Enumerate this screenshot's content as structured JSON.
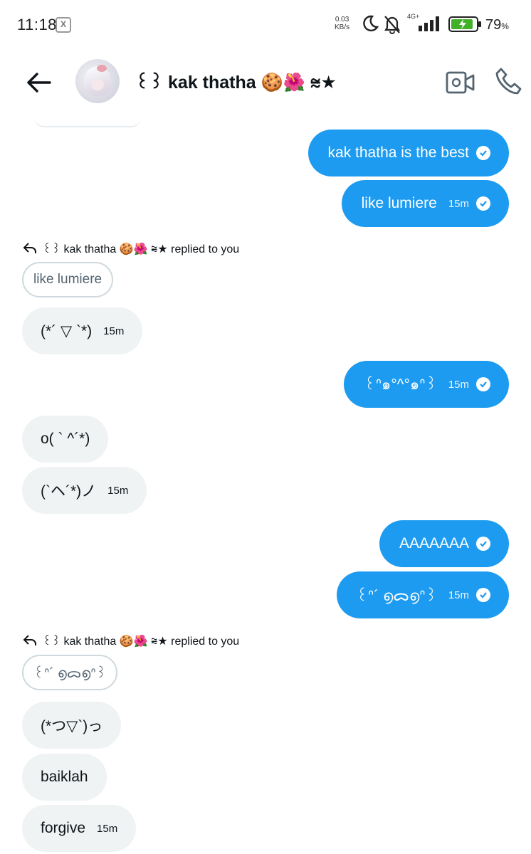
{
  "status_bar": {
    "time": "11:18",
    "speed_value": "0.03",
    "speed_unit": "KB/s",
    "network": "4G+",
    "battery": "79",
    "battery_unit": "%"
  },
  "header": {
    "title": "꒰꒱ kak thatha 🍪🌺 ⩬★"
  },
  "messages": [
    {
      "text": "kak thatha is the best"
    },
    {
      "text": "like lumiere",
      "time": "15m"
    },
    {
      "reply_label": "꒰꒱ kak thatha 🍪🌺 ⩬★ replied to you",
      "quote": "like lumiere"
    },
    {
      "text": "(*´ ▽ `*)",
      "time": "15m"
    },
    {
      "text": "꒰ᐢ๑°^°๑ᐢ꒱",
      "time": "15m"
    },
    {
      "text": "o( ` ^´*)"
    },
    {
      "text": "(`ヘ´*)ノ",
      "time": "15m"
    },
    {
      "text": "AAAAAAA"
    },
    {
      "text": "꒰ᐢ´ ൭ᯅ൭ᐢ꒱",
      "time": "15m"
    },
    {
      "reply_label": "꒰꒱ kak thatha 🍪🌺 ⩬★ replied to you",
      "quote": "꒰ᐢ´ ൭ᯅ൭ᐢ꒱"
    },
    {
      "text": "(*つ▽`)っ"
    },
    {
      "text": "baiklah"
    },
    {
      "text": "forgive",
      "time": "15m"
    }
  ],
  "colors": {
    "outgoing": "#1d9bf0",
    "incoming": "#eff3f4"
  }
}
